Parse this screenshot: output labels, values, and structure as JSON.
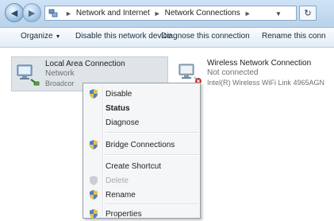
{
  "address": {
    "segments": [
      "Network and Internet",
      "Network Connections"
    ],
    "separator": "►"
  },
  "commands": {
    "organize": "Organize",
    "disable": "Disable this network device",
    "diagnose": "Diagnose this connection",
    "rename": "Rename this conn"
  },
  "connections": [
    {
      "name": "Local Area Connection",
      "status": "Network",
      "device": "Broadcor"
    },
    {
      "name": "Wireless Network Connection",
      "status": "Not connected",
      "device": "Intel(R) Wireless WiFi Link 4965AGN"
    }
  ],
  "context_menu": {
    "items": [
      {
        "label": "Disable"
      },
      {
        "label": "Status"
      },
      {
        "label": "Diagnose"
      },
      {
        "label": "Bridge Connections"
      },
      {
        "label": "Create Shortcut"
      },
      {
        "label": "Delete"
      },
      {
        "label": "Rename"
      },
      {
        "label": "Properties"
      }
    ]
  },
  "colors": {
    "selection": "#dfe4e8",
    "titlebar": "#c4dcf2",
    "menu_bg": "#f5f6f7"
  }
}
